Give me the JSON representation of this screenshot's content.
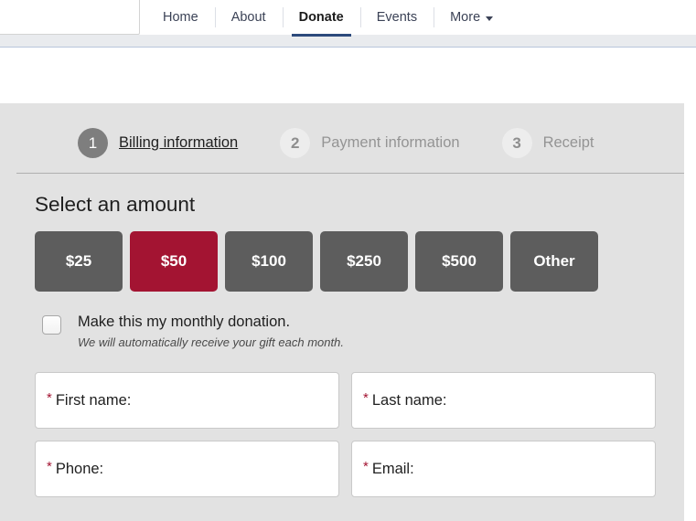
{
  "header": {
    "logo_placeholder": "",
    "nav": [
      {
        "label": "Home",
        "active": false,
        "has_caret": false
      },
      {
        "label": "About",
        "active": false,
        "has_caret": false
      },
      {
        "label": "Donate",
        "active": true,
        "has_caret": false
      },
      {
        "label": "Events",
        "active": false,
        "has_caret": false
      },
      {
        "label": "More",
        "active": false,
        "has_caret": true
      }
    ],
    "active_underline_color": "#2c4a7c"
  },
  "steps": [
    {
      "number": "1",
      "label": "Billing information",
      "state": "current"
    },
    {
      "number": "2",
      "label": "Payment information",
      "state": "upcoming"
    },
    {
      "number": "3",
      "label": "Receipt",
      "state": "upcoming"
    }
  ],
  "donation": {
    "section_title": "Select an amount",
    "amounts": [
      {
        "label": "$25",
        "selected": false
      },
      {
        "label": "$50",
        "selected": true
      },
      {
        "label": "$100",
        "selected": false
      },
      {
        "label": "$250",
        "selected": false
      },
      {
        "label": "$500",
        "selected": false
      },
      {
        "label": "Other",
        "selected": false
      }
    ],
    "selected_color": "#a31432",
    "unselected_color": "#5d5d5d",
    "recurring": {
      "checked": false,
      "label": "Make this my monthly donation.",
      "hint": "We will automatically receive your gift each month."
    },
    "fields": [
      {
        "required_marker": "*",
        "label": "First name:",
        "value": "",
        "placeholder": ""
      },
      {
        "required_marker": "*",
        "label": "Last name:",
        "value": "",
        "placeholder": ""
      },
      {
        "required_marker": "*",
        "label": "Phone:",
        "value": "",
        "placeholder": ""
      },
      {
        "required_marker": "*",
        "label": "Email:",
        "value": "",
        "placeholder": ""
      }
    ]
  }
}
